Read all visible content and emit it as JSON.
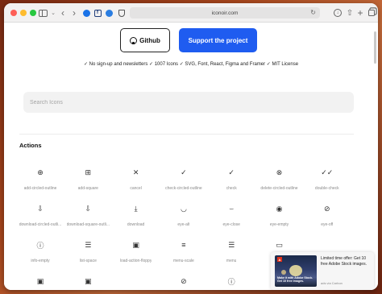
{
  "browser": {
    "url": "iconoir.com",
    "reload_glyph": "↻",
    "back_glyph": "‹",
    "forward_glyph": "›",
    "chevron_glyph": "⌄",
    "share_glyph": "⇧",
    "newtab_glyph": "+",
    "ext_badge": "f",
    "download_glyph": "↓"
  },
  "hero": {
    "github_label": "Github",
    "support_label": "Support the project",
    "features": "✓ No sign-up and newsletters ✓ 1007 Icons ✓ SVG, Font, React, Figma and Framer ✓ MIT License"
  },
  "search": {
    "placeholder": "Search Icons"
  },
  "section": {
    "title": "Actions"
  },
  "icons": [
    {
      "label": "add-circled-outline",
      "glyph": "⊕"
    },
    {
      "label": "add-square",
      "glyph": "⊞"
    },
    {
      "label": "cancel",
      "glyph": "✕"
    },
    {
      "label": "check-circled-outline",
      "glyph": "✓"
    },
    {
      "label": "check",
      "glyph": "✓"
    },
    {
      "label": "delete-circled-outline",
      "glyph": "⊗"
    },
    {
      "label": "double-check",
      "glyph": "✓✓"
    },
    {
      "label": "download-circled-outli...",
      "glyph": "⇩"
    },
    {
      "label": "download-square-outli...",
      "glyph": "⇩"
    },
    {
      "label": "download",
      "glyph": "⤓"
    },
    {
      "label": "eye-alt",
      "glyph": "◡"
    },
    {
      "label": "eye-close",
      "glyph": "⌣"
    },
    {
      "label": "eye-empty",
      "glyph": "◉"
    },
    {
      "label": "eye-off",
      "glyph": "⊘"
    },
    {
      "label": "info-empty",
      "glyph": "ⓘ"
    },
    {
      "label": "list-space",
      "glyph": "☰"
    },
    {
      "label": "load-action-floppy",
      "glyph": "▣"
    },
    {
      "label": "menu-scale",
      "glyph": "≡"
    },
    {
      "label": "menu",
      "glyph": "☰"
    },
    {
      "label": "",
      "glyph": "▭"
    },
    {
      "label": "",
      "glyph": ""
    },
    {
      "label": "",
      "glyph": "▣"
    },
    {
      "label": "",
      "glyph": "▣"
    },
    {
      "label": "",
      "glyph": ""
    },
    {
      "label": "",
      "glyph": "⊘"
    },
    {
      "label": "",
      "glyph": "ⓘ"
    },
    {
      "label": "",
      "glyph": "↑"
    },
    {
      "label": "",
      "glyph": ""
    }
  ],
  "ad": {
    "text": "Limited time offer: Get 10 free Adobe Stock images.",
    "via": "ads via Carbon",
    "image_caption": "Make it with Adobe Stock. Get 10 free images.",
    "logo": "A"
  }
}
